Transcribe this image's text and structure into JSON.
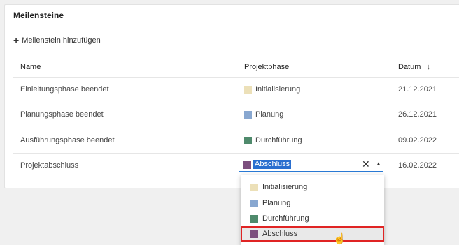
{
  "panel": {
    "title": "Meilensteine",
    "add_label": "Meilenstein hinzufügen"
  },
  "table": {
    "columns": {
      "name": "Name",
      "phase": "Projektphase",
      "date": "Datum",
      "sort_icon": "↓"
    },
    "rows": [
      {
        "name": "Einleitungsphase beendet",
        "phase": "Initialisierung",
        "color": "#ece0b8",
        "date": "21.12.2021"
      },
      {
        "name": "Planungsphase beendet",
        "phase": "Planung",
        "color": "#88a7d0",
        "date": "26.12.2021"
      },
      {
        "name": "Ausführungsphase beendet",
        "phase": "Durchführung",
        "color": "#4f8a6c",
        "date": "09.02.2022"
      },
      {
        "name": "Projektabschluss",
        "phase": "Abschluss",
        "color": "#7c4f7e",
        "date": "16.02.2022"
      }
    ]
  },
  "select": {
    "value": "Abschluss",
    "clear": "✕",
    "caret": "▲"
  },
  "dropdown": {
    "options": [
      {
        "label": "Initialisierung",
        "color": "#ece0b8"
      },
      {
        "label": "Planung",
        "color": "#88a7d0"
      },
      {
        "label": "Durchführung",
        "color": "#4f8a6c"
      },
      {
        "label": "Abschluss",
        "color": "#7c4f7e"
      }
    ]
  },
  "icons": {
    "plus": "+",
    "cursor": "☝"
  }
}
